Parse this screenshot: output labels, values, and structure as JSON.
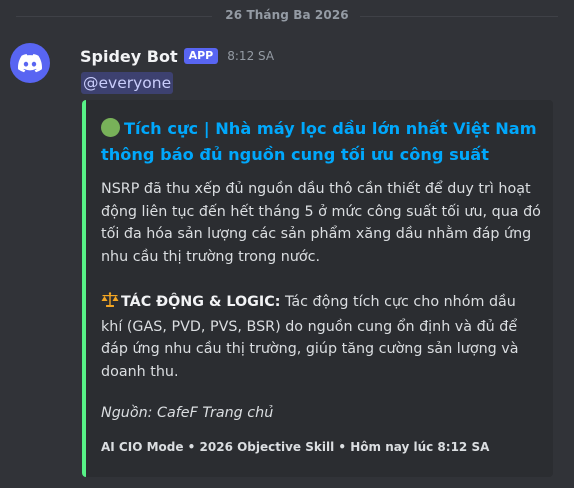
{
  "date_divider": "26 Tháng Ba 2026",
  "message": {
    "author": "Spidey Bot",
    "badge": "APP",
    "timestamp": "8:12 SA",
    "mention": "@everyone",
    "avatar_icon": "discord-logo-icon",
    "avatar_color": "#5865f2"
  },
  "embed": {
    "accent_color": "#57f287",
    "title_icon": "green-circle-icon",
    "title": "Tích cực | Nhà máy lọc dầu lớn nhất Việt Nam thông báo đủ nguồn cung tối ưu công suất",
    "description": "NSRP đã thu xếp đủ nguồn dầu thô cần thiết để duy trì hoạt động liên tục đến hết tháng 5 ở mức công suất tối ưu, qua đó tối đa hóa sản lượng các sản phẩm xăng dầu nhằm đáp ứng nhu cầu thị trường trong nước.",
    "impact_icon": "balance-scale-icon",
    "impact_label": "TÁC ĐỘNG & LOGIC:",
    "impact_text": " Tác động tích cực cho nhóm dầu khí (GAS, PVD, PVS, BSR) do nguồn cung ổn định và đủ để đáp ứng nhu cầu thị trường, giúp tăng cường sản lượng và doanh thu.",
    "source": "Nguồn: CafeF Trang chủ",
    "footer": "AI CIO Mode • 2026 Objective Skill • Hôm nay lúc 8:12 SA"
  }
}
